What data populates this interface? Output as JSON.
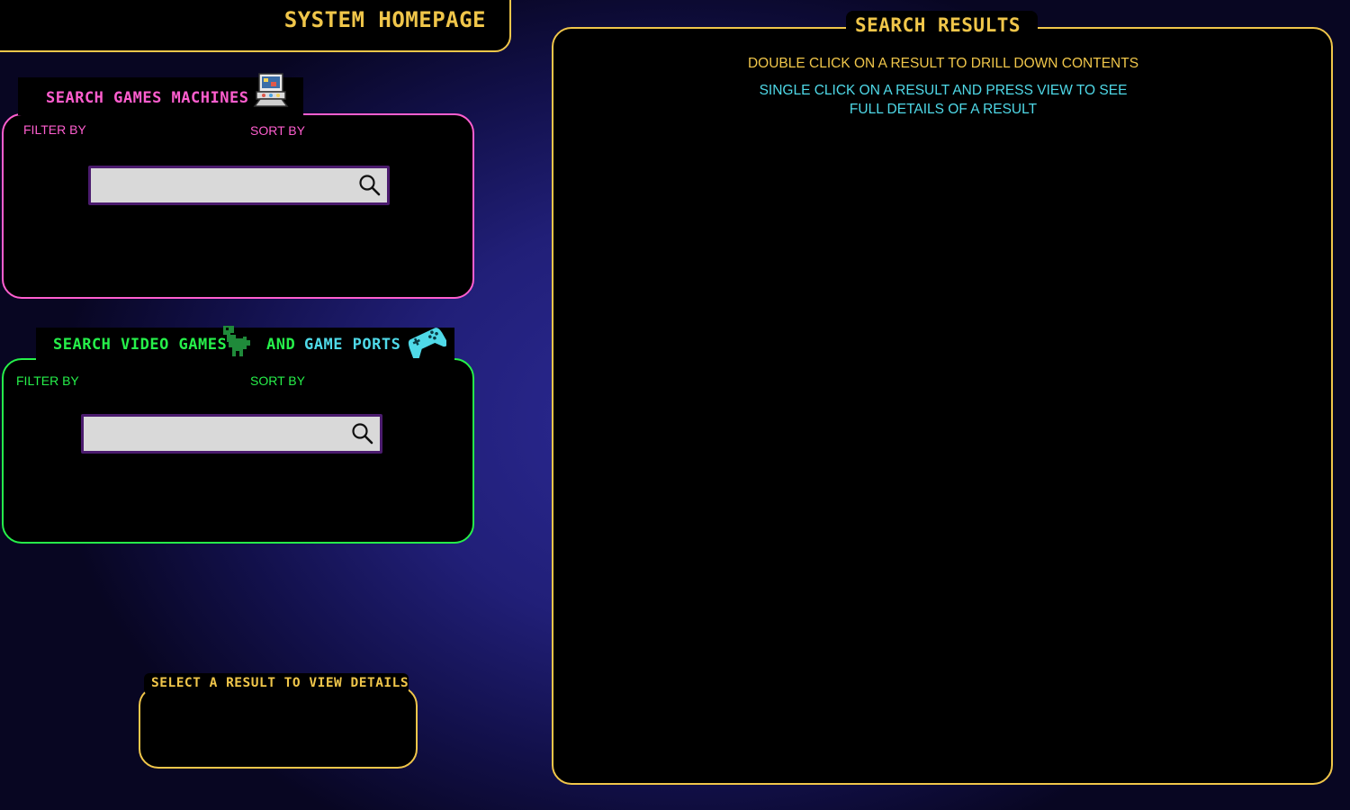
{
  "header": {
    "title": "SYSTEM HOMEPAGE"
  },
  "machines": {
    "title": "SEARCH GAMES MACHINES",
    "icon": "arcade-machine-icon",
    "filter_label": "FILTER BY",
    "sort_label": "SORT BY",
    "search_value": "",
    "search_icon": "search-icon"
  },
  "games": {
    "title": "SEARCH VIDEO GAMES",
    "icon": "dinosaur-icon",
    "and_label": "AND",
    "ports_label": "GAME PORTS",
    "ports_icon": "game-controller-icon",
    "filter_label": "FILTER BY",
    "sort_label": "SORT BY",
    "search_value": "",
    "search_icon": "search-icon"
  },
  "details": {
    "title": "SELECT A RESULT TO VIEW DETAILS"
  },
  "results": {
    "title": "SEARCH RESULTS",
    "hint_double_click": "DOUBLE CLICK ON A RESULT TO DRILL DOWN CONTENTS",
    "hint_single_click": "SINGLE CLICK ON A RESULT AND PRESS VIEW TO SEE FULL DETAILS OF A RESULT"
  },
  "colors": {
    "accent_gold": "#f0c64a",
    "machines_pink": "#ff5ecf",
    "games_green": "#26f04a",
    "ports_cyan": "#4fd9e8",
    "search_border": "#4b1b6e",
    "search_fill": "#d9d9d9"
  }
}
